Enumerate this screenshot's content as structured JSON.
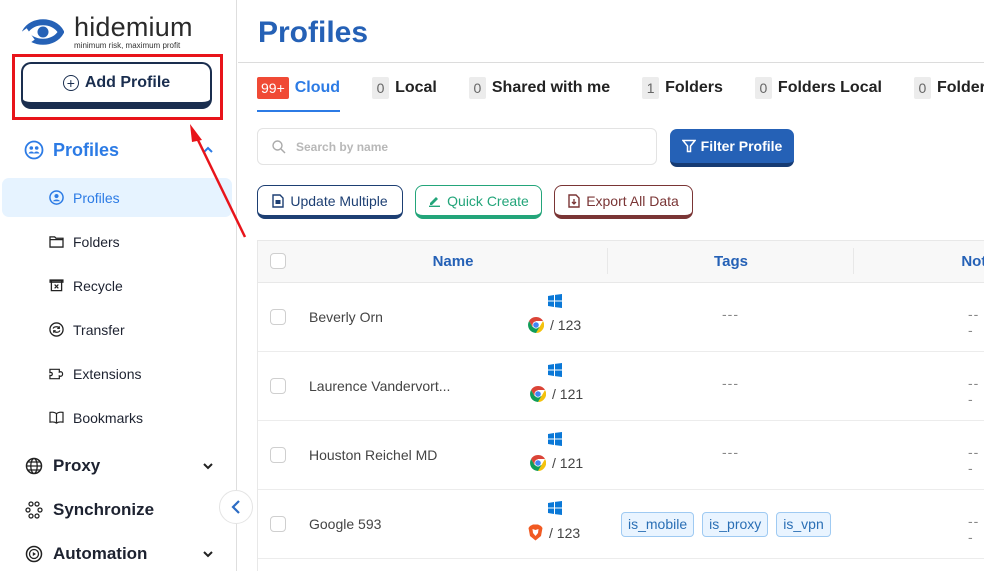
{
  "brand": {
    "name": "hidemium",
    "tagline": "minimum risk, maximum profit",
    "accent_color": "#2c7be5",
    "title_color": "#2561b6"
  },
  "sidebar": {
    "add_profile_label": "Add Profile",
    "groups": [
      {
        "label": "Profiles",
        "icon": "users-icon",
        "expanded": true
      },
      {
        "label": "Proxy",
        "icon": "globe-icon",
        "expanded": false
      },
      {
        "label": "Synchronize",
        "icon": "sync-nodes-icon"
      },
      {
        "label": "Automation",
        "icon": "automation-icon",
        "expanded": false
      }
    ],
    "profile_items": [
      {
        "label": "Profiles",
        "icon": "user-circle-icon",
        "active": true
      },
      {
        "label": "Folders",
        "icon": "folder-icon"
      },
      {
        "label": "Recycle",
        "icon": "recycle-bin-icon"
      },
      {
        "label": "Transfer",
        "icon": "transfer-icon"
      },
      {
        "label": "Extensions",
        "icon": "puzzle-icon"
      },
      {
        "label": "Bookmarks",
        "icon": "book-icon"
      }
    ]
  },
  "main": {
    "title": "Profiles",
    "tabs": [
      {
        "count": "99+",
        "label": "Cloud",
        "active": true
      },
      {
        "count": "0",
        "label": "Local"
      },
      {
        "count": "0",
        "label": "Shared with me"
      },
      {
        "count": "1",
        "label": "Folders"
      },
      {
        "count": "0",
        "label": "Folders Local"
      },
      {
        "count": "0",
        "label": "Folders Shared"
      }
    ],
    "search": {
      "placeholder": "Search by name",
      "value": ""
    },
    "filter_label": "Filter Profile",
    "actions": {
      "update_multiple": "Update Multiple",
      "quick_create": "Quick Create",
      "export_all": "Export All Data"
    },
    "table": {
      "columns": [
        "Name",
        "Tags",
        "Note"
      ],
      "rows": [
        {
          "name": "Beverly Orn",
          "os": "windows",
          "browser": "chrome",
          "version": "/ 123",
          "tags": [],
          "tags_empty": "---",
          "note": "---"
        },
        {
          "name": "Laurence Vandervort...",
          "os": "windows",
          "browser": "chrome",
          "version": "/ 121",
          "tags": [],
          "tags_empty": "---",
          "note": "---"
        },
        {
          "name": "Houston Reichel MD",
          "os": "windows",
          "browser": "chrome",
          "version": "/ 121",
          "tags": [],
          "tags_empty": "---",
          "note": "---"
        },
        {
          "name": "Google 593",
          "os": "windows",
          "browser": "brave",
          "version": "/ 123",
          "tags": [
            "is_mobile",
            "is_proxy",
            "is_vpn"
          ],
          "tags_empty": "",
          "note": "---"
        }
      ]
    }
  }
}
